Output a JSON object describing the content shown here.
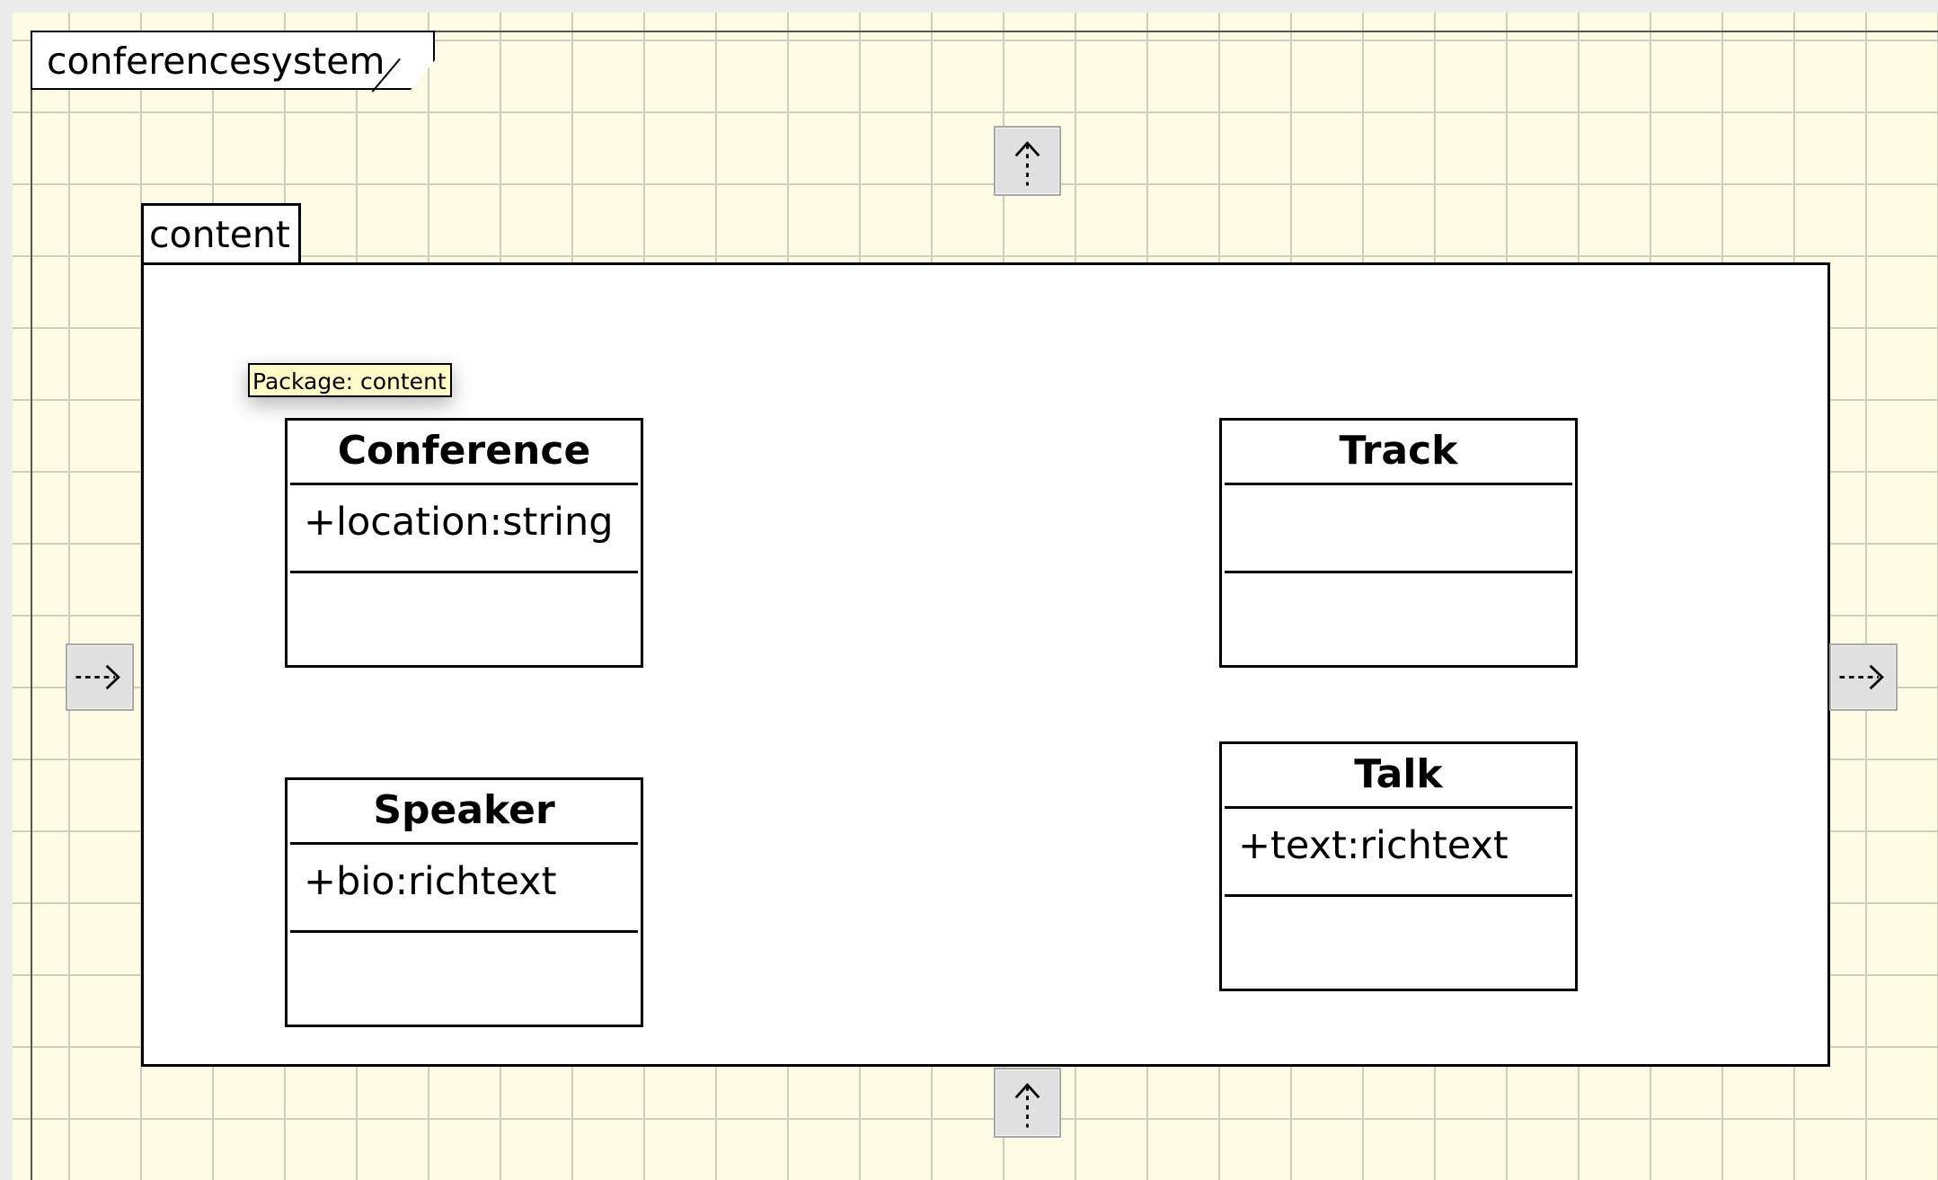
{
  "diagram": {
    "type": "uml-class-diagram",
    "outer_package": {
      "name": "conferencesystem"
    },
    "inner_package": {
      "name": "content",
      "tooltip": "Package: content"
    },
    "classes": [
      {
        "name": "Conference",
        "attributes": [
          "+location:string"
        ],
        "operations": []
      },
      {
        "name": "Track",
        "attributes": [],
        "operations": []
      },
      {
        "name": "Speaker",
        "attributes": [
          "+bio:richtext"
        ],
        "operations": []
      },
      {
        "name": "Talk",
        "attributes": [
          "+text:richtext"
        ],
        "operations": []
      }
    ],
    "handles": [
      {
        "icon": "dashed-arrow-up-icon"
      },
      {
        "icon": "dashed-arrow-right-icon"
      },
      {
        "icon": "dashed-arrow-right-icon"
      },
      {
        "icon": "dashed-arrow-up-icon"
      }
    ],
    "colors": {
      "canvas_background": "#fdfbe4",
      "grid_line": "#cfcdc0",
      "tooltip_background": "#fffbc8",
      "handle_background": "#e0e0e0"
    }
  }
}
